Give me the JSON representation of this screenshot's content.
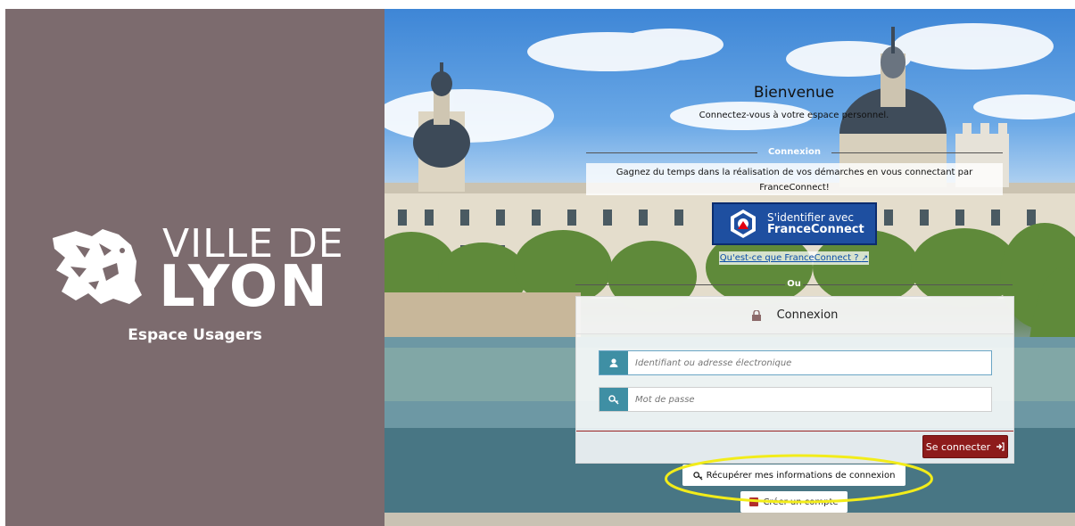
{
  "brand": {
    "line1": "VILLE DE",
    "line2": "LYON",
    "subtitle": "Espace Usagers",
    "logo_icon": "lion-emblem-icon",
    "panel_color": "#7c6b6e"
  },
  "welcome": {
    "title": "Bienvenue",
    "subtitle": "Connectez-vous à votre espace personnel."
  },
  "franceconnect": {
    "section_label": "Connexion",
    "description": "Gagnez du temps dans la réalisation de vos démarches en vous connectant par FranceConnect!",
    "button_line1": "S'identifier avec",
    "button_line2": "FranceConnect",
    "what_link": "Qu'est-ce que FranceConnect ?",
    "button_color": "#1e4fa0"
  },
  "separator": {
    "label": "Ou"
  },
  "login_card": {
    "title": "Connexion",
    "username_placeholder": "Identifiant ou adresse électronique",
    "password_placeholder": "Mot de passe",
    "submit_label": "Se connecter",
    "accent_color": "#8d1b1b",
    "addon_color": "#3f8fa4"
  },
  "links": {
    "recover": "Récupérer mes informations de connexion",
    "create": "Créer un compte"
  },
  "annotation": {
    "highlight_color": "#f2ec1a"
  }
}
